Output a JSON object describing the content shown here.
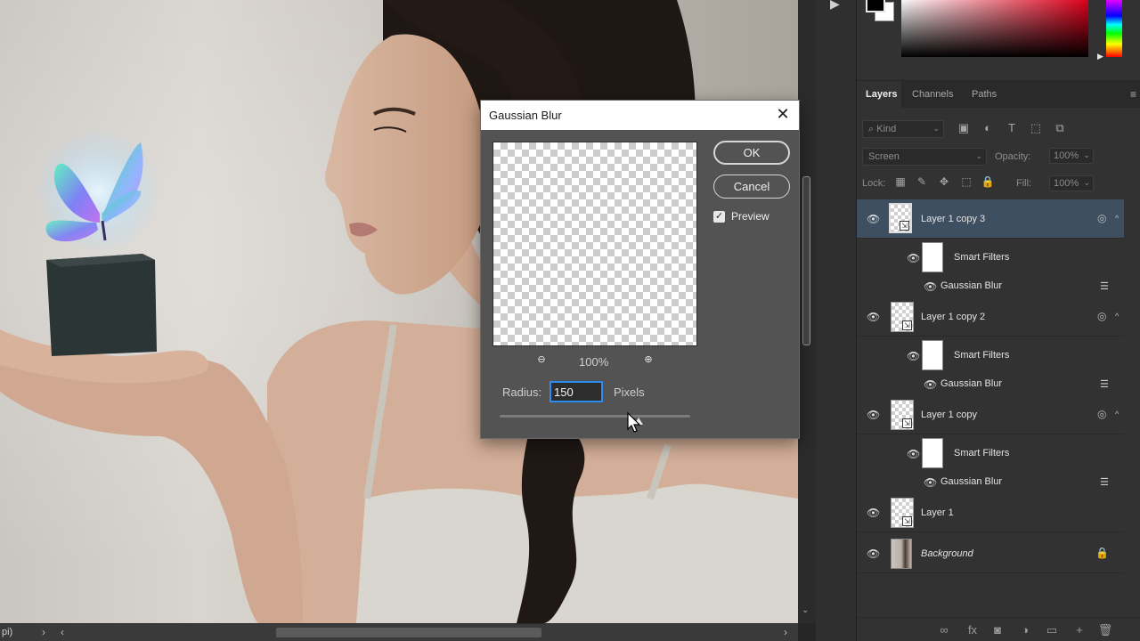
{
  "status_bar": {
    "zoom_fragment": "pi)",
    "nav_right_glyph": "›",
    "nav_left_glyph": "‹",
    "scroll_right_glyph": "›"
  },
  "toolstrip": {
    "play_glyph": "▶"
  },
  "vscroll": {
    "down_glyph": "⌄"
  },
  "color_panel": {
    "hue_marker_glyph": "▶"
  },
  "layers_panel": {
    "tabs": [
      {
        "label": "Layers",
        "active": true
      },
      {
        "label": "Channels",
        "active": false
      },
      {
        "label": "Paths",
        "active": false
      }
    ],
    "menu_glyph": "≡",
    "filter_kind": {
      "label": "Kind",
      "chevron": "⌄",
      "search_glyph": "⌕"
    },
    "filter_icons": [
      "image-filter-icon",
      "adjustment-filter-icon",
      "type-filter-icon",
      "shape-filter-icon",
      "smart-object-filter-icon"
    ],
    "filter_icon_glyphs": [
      "▣",
      "◐",
      "T",
      "⬚",
      "⧉"
    ],
    "blend_mode": "Screen",
    "opacity_label": "Opacity:",
    "opacity_value": "100%",
    "lock_label": "Lock:",
    "lock_icon_glyphs": [
      "▦",
      "✎",
      "✥",
      "⬚",
      "🔒"
    ],
    "fill_label": "Fill:",
    "fill_value": "100%",
    "chevron": "⌄",
    "eye_glyph": "👁",
    "badge_glyph": "⇲",
    "fx_glyph": "◎",
    "fx_caret_glyph": "^",
    "settings_glyph": "☰",
    "lock_badge_glyph": "🔒",
    "layers": [
      {
        "name": "Layer 1 copy 3",
        "selected": true,
        "smart_filters": {
          "label": "Smart Filters",
          "filter": "Gaussian Blur"
        }
      },
      {
        "name": "Layer 1 copy 2",
        "selected": false,
        "smart_filters": {
          "label": "Smart Filters",
          "filter": "Gaussian Blur"
        }
      },
      {
        "name": "Layer 1 copy",
        "selected": false,
        "smart_filters": {
          "label": "Smart Filters",
          "filter": "Gaussian Blur"
        }
      },
      {
        "name": "Layer 1",
        "selected": false
      },
      {
        "name": "Background",
        "selected": false,
        "locked": true
      }
    ],
    "footer_icon_glyphs": [
      "∞",
      "fx",
      "◙",
      "◑",
      "▭",
      "+",
      "🗑"
    ]
  },
  "dialog": {
    "title": "Gaussian Blur",
    "close_glyph": "✕",
    "ok_label": "OK",
    "cancel_label": "Cancel",
    "preview_label": "Preview",
    "preview_checked": true,
    "check_glyph": "✓",
    "zoom_out_glyph": "⊖",
    "zoom_in_glyph": "⊕",
    "zoom_percent": "100%",
    "radius_label": "Radius:",
    "radius_value": "150",
    "radius_unit": "Pixels",
    "slider_position": 0.73
  }
}
